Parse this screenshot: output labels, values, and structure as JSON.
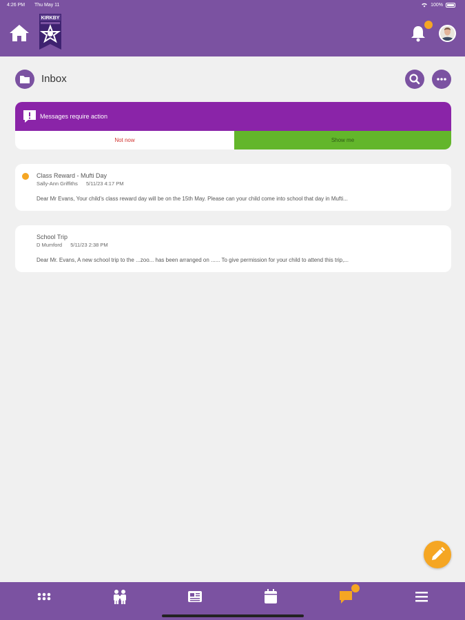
{
  "status_bar": {
    "time": "4:26 PM",
    "date": "Thu May 11",
    "battery": "100%"
  },
  "header": {
    "logo_text": "KIRKBY",
    "home_icon": "home-icon",
    "bell_icon": "bell-icon",
    "avatar": "user-avatar"
  },
  "inbox": {
    "title": "Inbox",
    "folder_icon": "folder-icon",
    "search_icon": "search-icon",
    "more_icon": "more-icon"
  },
  "action_banner": {
    "message": "Messages require action",
    "icon": "alert-message-icon",
    "not_now_label": "Not now",
    "show_me_label": "Show me",
    "colors": {
      "banner": "#8a24a8",
      "not_now_text": "#d0312d",
      "show_me_bg": "#63b62b"
    }
  },
  "messages": [
    {
      "subject": "Class Reward - Mufti Day",
      "sender": "Sally-Ann Griffiths",
      "date": "5/11/23 4:17 PM",
      "preview": "Dear Mr Evans, Your child's class reward day will be on the 15th May. Please can your child come into school that day in Mufti...",
      "unread": true
    },
    {
      "subject": "School Trip",
      "sender": "D Mumford",
      "date": "5/11/23 2:38 PM",
      "preview": "Dear Mr. Evans, A new school trip to the ...zoo... has been arranged on ...... To give permission for your child to attend this trip,...",
      "unread": false
    }
  ],
  "fab": {
    "icon": "pencil-icon"
  },
  "bottom_nav": [
    {
      "name": "apps",
      "icon": "grid-icon"
    },
    {
      "name": "people",
      "icon": "people-icon"
    },
    {
      "name": "news",
      "icon": "newspaper-icon"
    },
    {
      "name": "calendar",
      "icon": "calendar-icon"
    },
    {
      "name": "messages",
      "icon": "chat-icon",
      "badge": true
    },
    {
      "name": "menu",
      "icon": "menu-icon"
    }
  ],
  "theme": {
    "primary": "#7b52a1",
    "accent": "#f5a623",
    "background": "#f0f0f0"
  }
}
